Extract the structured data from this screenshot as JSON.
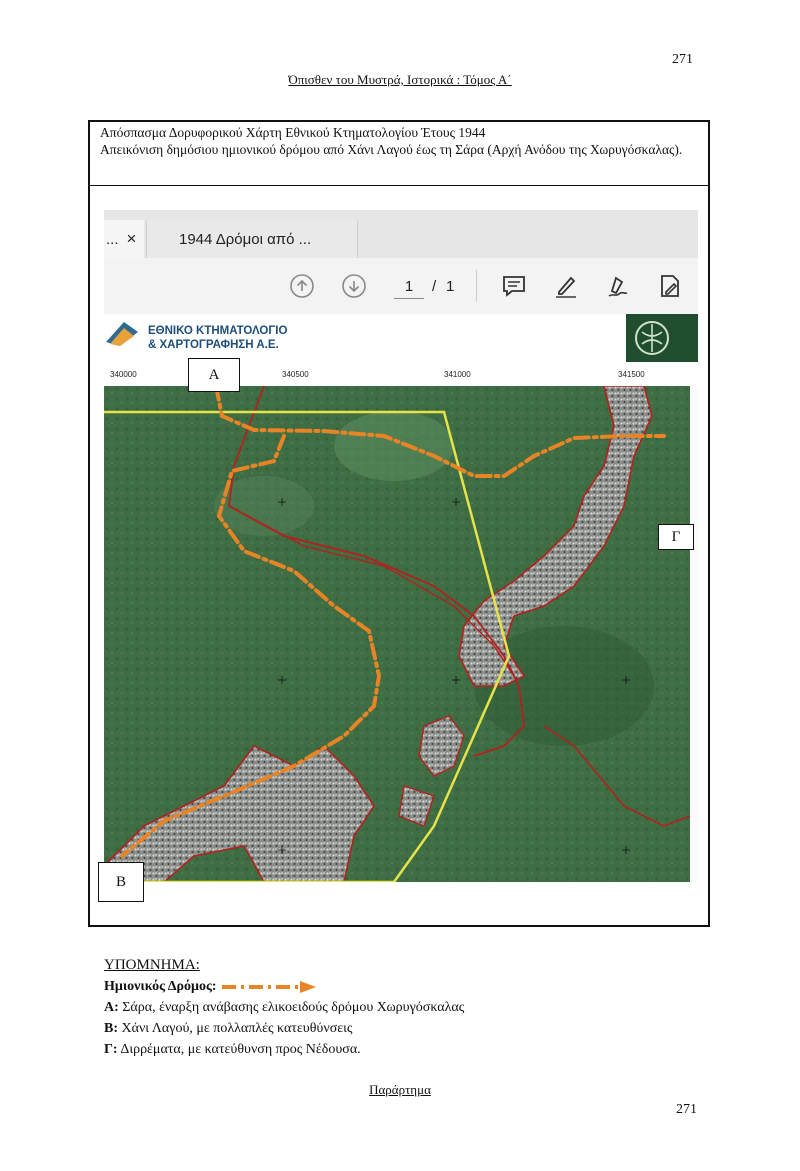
{
  "page": {
    "number_top": "271",
    "running_head": "Όπισθεν του Μυστρά, Ιστορικά : Τόμος Α΄",
    "footer": "Παράρτημα",
    "number_bottom": "271"
  },
  "caption": {
    "line1": "Απόσπασμα Δορυφορικού Χάρτη Εθνικού Κτηματολογίου Έτους 1944",
    "line2": "Απεικόνιση δημόσιου ημιονικού δρόμου από Χάνι Λαγού έως τη Σάρα (Αρχή Ανόδου της Χωρυγόσκαλας)."
  },
  "viewer": {
    "tab_prev": "...",
    "tab_close": "×",
    "tab_active": "1944 Δρόμοι από ...",
    "page_current": "1",
    "page_sep": "/",
    "page_total": "1",
    "icons": [
      "arrow-up-icon",
      "arrow-down-icon",
      "comment-icon",
      "draw-icon",
      "ink-icon",
      "edit-file-icon"
    ]
  },
  "map": {
    "org_name_line1": "ΕΘΝΙΚΟ ΚΤΗΜΑΤΟΛΟΓΙΟ",
    "org_name_line2": "& ΧΑΡΤΟΓΡΑΦΗΣΗ Α.Ε.",
    "ticks": [
      "340000",
      "340500",
      "341000",
      "341500"
    ],
    "label_a": "Α",
    "label_b": "Β",
    "label_g": "Γ",
    "colors": {
      "terrain": "#3f6e45",
      "route": "#e88426",
      "boundary": "#b5201e",
      "yellow_line": "#e6e24a"
    }
  },
  "legend": {
    "title": "ΥΠΟΜΝΗΜΑ:",
    "route_label": "Ημιονικός Δρόμος:",
    "items": [
      {
        "key": "Α:",
        "text": "Σάρα, έναρξη ανάβασης ελικοειδούς δρόμου Χωρυγόσκαλας"
      },
      {
        "key": "Β:",
        "text": "Χάνι Λαγού, με πολλαπλές κατευθύνσεις"
      },
      {
        "key": "Γ:",
        "text": "Διρρέματα, με κατεύθυνση προς Νέδουσα."
      }
    ]
  }
}
